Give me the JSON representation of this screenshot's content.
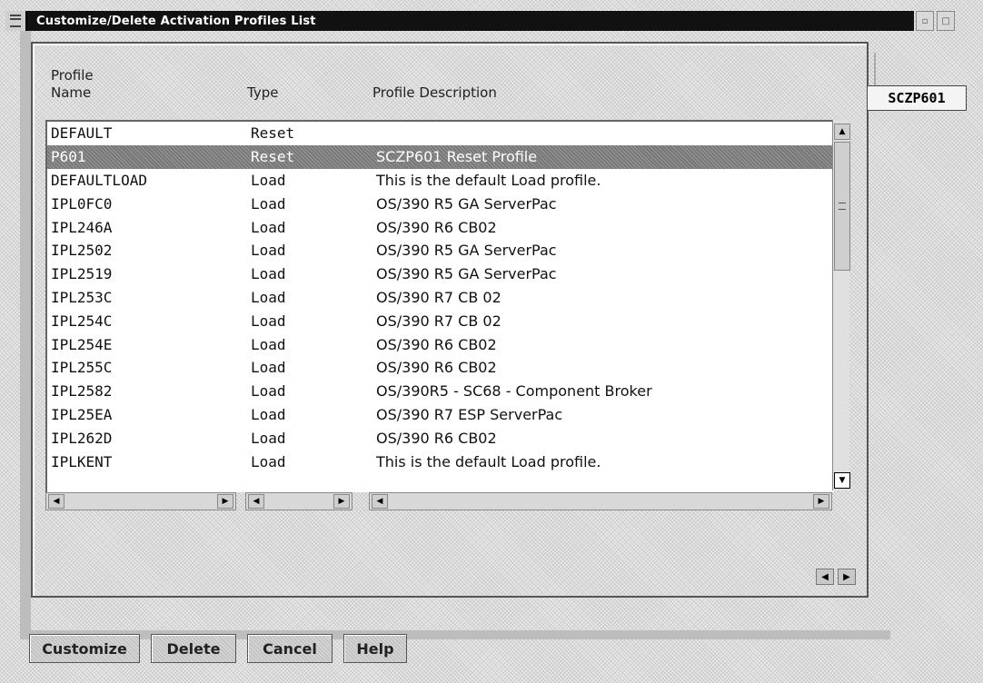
{
  "window": {
    "title": "Customize/Delete Activation Profiles List"
  },
  "columns": {
    "profile_label": "Profile",
    "name_label": "Name",
    "type_label": "Type",
    "description_label": "Profile Description"
  },
  "profiles": [
    {
      "name": "DEFAULT",
      "type": "Reset",
      "description": ""
    },
    {
      "name": "P601",
      "type": "Reset",
      "description": "SCZP601 Reset Profile",
      "selected": true
    },
    {
      "name": "DEFAULTLOAD",
      "type": "Load",
      "description": "This is the default Load profile."
    },
    {
      "name": "IPL0FC0",
      "type": "Load",
      "description": "OS/390 R5 GA ServerPac"
    },
    {
      "name": "IPL246A",
      "type": "Load",
      "description": "OS/390 R6 CB02"
    },
    {
      "name": "IPL2502",
      "type": "Load",
      "description": "OS/390 R5 GA ServerPac"
    },
    {
      "name": "IPL2519",
      "type": "Load",
      "description": "OS/390 R5 GA ServerPac"
    },
    {
      "name": "IPL253C",
      "type": "Load",
      "description": "OS/390 R7 CB 02"
    },
    {
      "name": "IPL254C",
      "type": "Load",
      "description": "OS/390 R7 CB 02"
    },
    {
      "name": "IPL254E",
      "type": "Load",
      "description": "OS/390 R6 CB02"
    },
    {
      "name": "IPL255C",
      "type": "Load",
      "description": "OS/390 R6 CB02"
    },
    {
      "name": "IPL2582",
      "type": "Load",
      "description": "OS/390R5 - SC68 - Component Broker"
    },
    {
      "name": "IPL25EA",
      "type": "Load",
      "description": "OS/390 R7 ESP ServerPac"
    },
    {
      "name": "IPL262D",
      "type": "Load",
      "description": "OS/390 R6 CB02"
    },
    {
      "name": "IPLKENT",
      "type": "Load",
      "description": "This is the default Load profile."
    }
  ],
  "side": {
    "label": "SCZP601"
  },
  "buttons": {
    "customize": "Customize",
    "delete": "Delete",
    "cancel": "Cancel",
    "help": "Help"
  },
  "icons": {
    "system_menu": "system-menu-icon",
    "minimize": "minimize-icon",
    "maximize": "maximize-icon",
    "scroll_up": "arrow-up-icon",
    "scroll_down": "arrow-down-icon",
    "scroll_left": "arrow-left-icon",
    "scroll_right": "arrow-right-icon"
  }
}
